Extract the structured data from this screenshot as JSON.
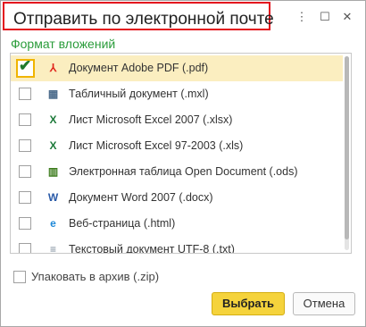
{
  "window": {
    "title": "Отправить по электронной почте",
    "more_glyph": "⋮",
    "maximize_glyph": "☐",
    "close_glyph": "✕"
  },
  "attachment_format": {
    "label": "Формат вложений",
    "items": [
      {
        "label": "Документ Adobe PDF (.pdf)",
        "checked": true,
        "icon": "pdf-icon",
        "icon_glyph": "⅄",
        "icon_color": "#e0241b"
      },
      {
        "label": "Табличный документ (.mxl)",
        "checked": false,
        "icon": "spreadsheet-doc-icon",
        "icon_glyph": "▦",
        "icon_color": "#4a6a8a"
      },
      {
        "label": "Лист Microsoft Excel 2007 (.xlsx)",
        "checked": false,
        "icon": "excel-icon",
        "icon_glyph": "X",
        "icon_color": "#1d7a3a"
      },
      {
        "label": "Лист Microsoft Excel 97-2003 (.xls)",
        "checked": false,
        "icon": "excel-icon",
        "icon_glyph": "X",
        "icon_color": "#1d7a3a"
      },
      {
        "label": "Электронная таблица Open Document (.ods)",
        "checked": false,
        "icon": "ods-icon",
        "icon_glyph": "▥",
        "icon_color": "#3a7a1a"
      },
      {
        "label": "Документ Word 2007 (.docx)",
        "checked": false,
        "icon": "word-icon",
        "icon_glyph": "W",
        "icon_color": "#2a5aa8"
      },
      {
        "label": "Веб-страница (.html)",
        "checked": false,
        "icon": "web-page-icon",
        "icon_glyph": "e",
        "icon_color": "#1e88d8"
      },
      {
        "label": "Текстовый документ UTF-8 (.txt)",
        "checked": false,
        "icon": "text-file-icon",
        "icon_glyph": "≡",
        "icon_color": "#7a8a9a"
      }
    ]
  },
  "zip": {
    "label": "Упаковать в архив (.zip)",
    "checked": false
  },
  "buttons": {
    "select": "Выбрать",
    "cancel": "Отмена"
  },
  "colors": {
    "accent_green": "#2a9c3a",
    "selected_row": "#fbeec0",
    "primary_button": "#f5d33c",
    "title_highlight": "#e3141e"
  }
}
